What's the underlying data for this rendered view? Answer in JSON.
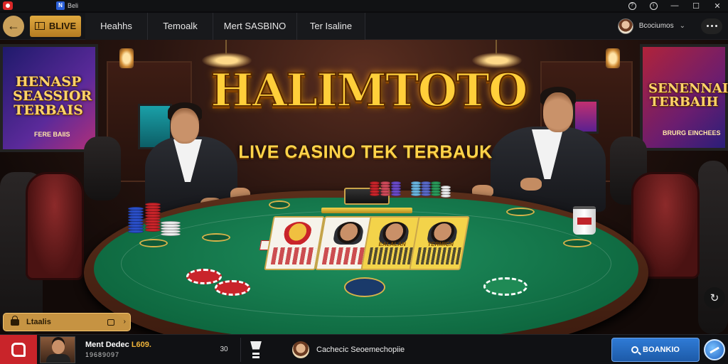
{
  "window": {
    "app_name": "",
    "site_icon_letter": "N",
    "site_tab": "Beli",
    "help_icon": "?",
    "info_icon": "i",
    "minimize": "—",
    "maximize": "☐",
    "close": "✕"
  },
  "nav": {
    "back_icon": "←",
    "live_label": "BLIVE",
    "tabs": [
      "Heahhs",
      "Temoalk",
      "Mert SASBINO",
      "Ter Isaline"
    ],
    "user_name": "Bcociumos",
    "chevron": "⌄"
  },
  "hero": {
    "brand_title": "HALIMTOTO",
    "tagline": "LIVE CASINO TEK TERBAUK",
    "left_screen_title": "HENASP SEASSIOR TERBAIS",
    "left_screen_sub": "FERE BAIIS",
    "right_screen_title": "SENENNAIT TERBAIH",
    "right_screen_sub": "BRURG EINCHEES"
  },
  "cards": [
    {
      "text": ""
    },
    {
      "text": ""
    },
    {
      "text": "EALALAN"
    },
    {
      "text": "TERMICN"
    }
  ],
  "overlay": {
    "search_text": "Ltaalis",
    "chevron": "›",
    "refresh_icon": "↻"
  },
  "bottom": {
    "winner_name": "Ment Dedec",
    "winner_amount_highlight": "L609.",
    "winner_amount": "19689097",
    "winner_count": "30",
    "chat_text": "Cachecic Seoemechopiie",
    "cta_label": "BOANKIO"
  },
  "colors": {
    "accent_gold": "#d6a048",
    "brand_red": "#c9242a",
    "felt_green": "#0f6a41",
    "cta_blue": "#2f7bd6"
  }
}
